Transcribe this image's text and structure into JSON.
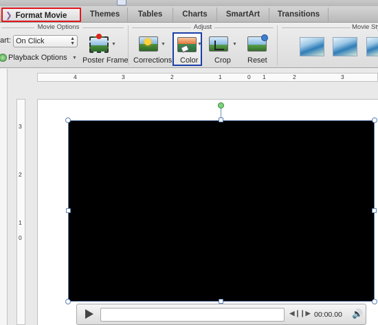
{
  "tabs": [
    {
      "label": "Format Movie",
      "active": true
    },
    {
      "label": "Themes"
    },
    {
      "label": "Tables"
    },
    {
      "label": "Charts"
    },
    {
      "label": "SmartArt"
    },
    {
      "label": "Transitions"
    }
  ],
  "ribbon": {
    "movie_options": {
      "title": "Movie Options",
      "start_label": "art:",
      "start_value": "On Click",
      "playback_label": "Playback Options",
      "poster_frame_label": "Poster Frame"
    },
    "adjust": {
      "title": "Adjust",
      "corrections_label": "Corrections",
      "color_label": "Color",
      "crop_label": "Crop",
      "reset_label": "Reset"
    },
    "movie_styles": {
      "title": "Movie Sty"
    }
  },
  "hruler_labels": [
    "4",
    "3",
    "2",
    "1",
    "0",
    "1",
    "2",
    "3"
  ],
  "vruler_labels": [
    "3",
    "2",
    "1",
    "0"
  ],
  "player": {
    "time": "00:00.00"
  },
  "colors": {
    "active_tab_border": "#e0161b",
    "selected_button_border": "#1a3fa8",
    "selection_handle": "#5b7fb3",
    "rotation_handle": "#7cd07c"
  }
}
